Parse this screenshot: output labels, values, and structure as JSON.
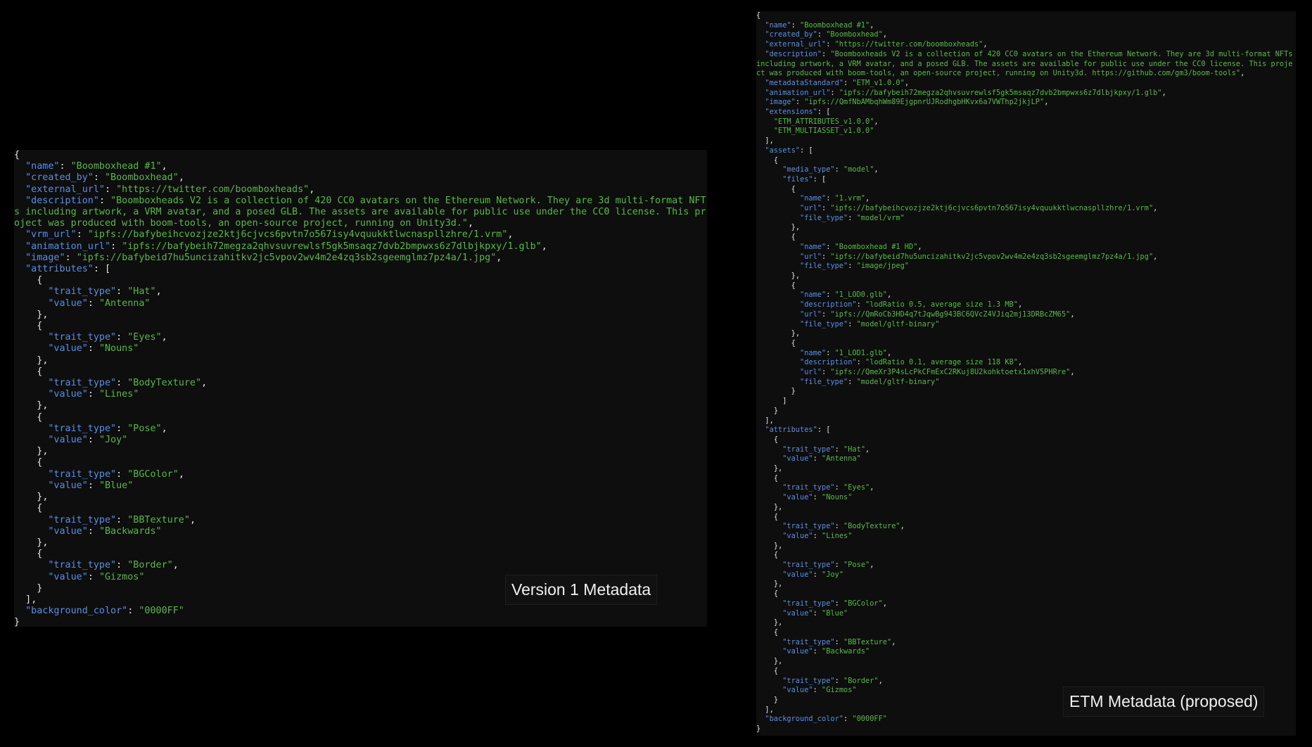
{
  "captions": {
    "left": "Version 1 Metadata",
    "right": "ETM Metadata (proposed)"
  },
  "colors": {
    "background": "#000000",
    "panel": "#0e0e0e",
    "key": "#5b8fe3",
    "string": "#59b84a",
    "punctuation": "#e6e6e6"
  },
  "left_json": {
    "name": "Boomboxhead #1",
    "created_by": "Boomboxhead",
    "external_url": "https://twitter.com/boomboxheads",
    "description": "Boomboxheads V2 is a collection of 420 CC0 avatars on the Ethereum Network. They are 3d multi-format NFTs including artwork, a VRM avatar, and a posed GLB. The assets are available for public use under the CC0 license. This project was produced with boom-tools, an open-source project, running on Unity3d.",
    "vrm_url": "ipfs://bafybeihcvozjze2ktj6cjvcs6pvtn7o567isy4vquukktlwcnaspllzhre/1.vrm",
    "animation_url": "ipfs://bafybeih72megza2qhvsuvrewlsf5gk5msaqz7dvb2bmpwxs6z7dlbjkpxy/1.glb",
    "image": "ipfs://bafybeid7hu5uncizahitkv2jc5vpov2wv4m2e4zq3sb2sgeemglmz7pz4a/1.jpg",
    "attributes": [
      {
        "trait_type": "Hat",
        "value": "Antenna"
      },
      {
        "trait_type": "Eyes",
        "value": "Nouns"
      },
      {
        "trait_type": "BodyTexture",
        "value": "Lines"
      },
      {
        "trait_type": "Pose",
        "value": "Joy"
      },
      {
        "trait_type": "BGColor",
        "value": "Blue"
      },
      {
        "trait_type": "BBTexture",
        "value": "Backwards"
      },
      {
        "trait_type": "Border",
        "value": "Gizmos"
      }
    ],
    "background_color": "0000FF"
  },
  "right_json": {
    "name": "Boomboxhead #1",
    "created_by": "Boomboxhead",
    "external_url": "https://twitter.com/boomboxheads",
    "description": "Boomboxheads V2 is a collection of 420 CC0 avatars on the Ethereum Network. They are 3d multi-format NFTs including artwork, a VRM avatar, and a posed GLB. The assets are available for public use under the CC0 license. This project was produced with boom-tools, an open-source project, running on Unity3d. https://github.com/gm3/boom-tools",
    "metadataStandard": "ETM_v1.0.0",
    "animation_url": "ipfs://bafybeih72megza2qhvsuvrewlsf5gk5msaqz7dvb2bmpwxs6z7dlbjkpxy/1.glb",
    "image": "ipfs://QmfNbAMbqhWm89EjgpnrUJRodhgbHKvx6a7VWThp2jkjLP",
    "extensions": [
      "ETM_ATTRIBUTES_v1.0.0",
      "ETM_MULTIASSET_v1.0.0"
    ],
    "assets": [
      {
        "media_type": "model",
        "files": [
          {
            "name": "1.vrm",
            "url": "ipfs://bafybeihcvozjze2ktj6cjvcs6pvtn7o567isy4vquukktlwcnaspllzhre/1.vrm",
            "file_type": "model/vrm"
          },
          {
            "name": "Boomboxhead #1 HD",
            "url": "ipfs://bafybeid7hu5uncizahitkv2jc5vpov2wv4m2e4zq3sb2sgeemglmz7pz4a/1.jpg",
            "file_type": "image/jpeg"
          },
          {
            "name": "1_LOD0.glb",
            "description": "lodRatio 0.5, average size 1.3 MB",
            "url": "ipfs://QmRoCb3HD4q7tJqwBg943BC6QVcZ4VJiq2mj13DRBcZM65",
            "file_type": "model/gltf-binary"
          },
          {
            "name": "1_LOD1.glb",
            "description": "lodRatio 0.1, average size 118 KB",
            "url": "ipfs://QmeXr3P4sLcPkCFmExC2RKuj8U2kohktoetx1xhV5PHRre",
            "file_type": "model/gltf-binary"
          }
        ]
      }
    ],
    "attributes": [
      {
        "trait_type": "Hat",
        "value": "Antenna"
      },
      {
        "trait_type": "Eyes",
        "value": "Nouns"
      },
      {
        "trait_type": "BodyTexture",
        "value": "Lines"
      },
      {
        "trait_type": "Pose",
        "value": "Joy"
      },
      {
        "trait_type": "BGColor",
        "value": "Blue"
      },
      {
        "trait_type": "BBTexture",
        "value": "Backwards"
      },
      {
        "trait_type": "Border",
        "value": "Gizmos"
      }
    ],
    "background_color": "0000FF"
  }
}
